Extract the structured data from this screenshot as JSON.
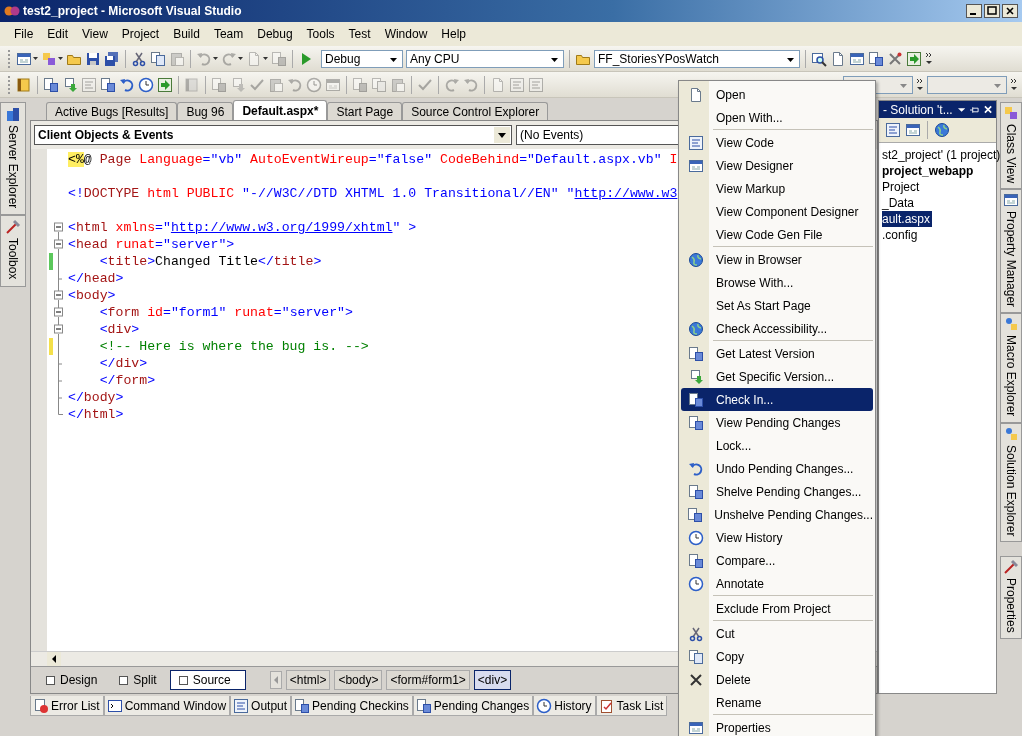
{
  "window": {
    "title": "test2_project - Microsoft Visual Studio"
  },
  "menu_bar": [
    "File",
    "Edit",
    "View",
    "Project",
    "Build",
    "Team",
    "Debug",
    "Tools",
    "Test",
    "Window",
    "Help"
  ],
  "toolbar": {
    "configuration": "Debug",
    "platform": "Any CPU",
    "startup_item": "FF_StoriesYPosWatch"
  },
  "side_tabs_left": [
    "Server Explorer",
    "Toolbox"
  ],
  "document_tabs": [
    {
      "label": "Active Bugs [Results]",
      "selected": false
    },
    {
      "label": "Bug 96",
      "selected": false
    },
    {
      "label": "Default.aspx*",
      "selected": true
    },
    {
      "label": "Start Page",
      "selected": false
    },
    {
      "label": "Source Control Explorer",
      "selected": false
    }
  ],
  "editor": {
    "object_list": "Client Objects & Events",
    "event_list": "(No Events)",
    "lines": [
      {
        "kind": "plain",
        "tokens": [
          {
            "kind": "hl",
            "text": "<%"
          },
          {
            "kind": "text",
            "text": "@"
          },
          {
            "kind": "tag",
            "text": " Page"
          },
          {
            "kind": "attr",
            "text": " Language"
          },
          {
            "kind": "delim",
            "text": "="
          },
          {
            "kind": "value",
            "text": "\"vb\""
          },
          {
            "kind": "attr",
            "text": " AutoEventWireup"
          },
          {
            "kind": "delim",
            "text": "="
          },
          {
            "kind": "value",
            "text": "\"false\""
          },
          {
            "kind": "attr",
            "text": " CodeBehind"
          },
          {
            "kind": "delim",
            "text": "="
          },
          {
            "kind": "value",
            "text": "\"Default.aspx.vb\""
          },
          {
            "kind": "attr",
            "text": " I"
          }
        ]
      },
      {
        "kind": "plain",
        "blank_before": true,
        "tokens": [
          {
            "kind": "delim",
            "text": "<!"
          },
          {
            "kind": "tag",
            "text": "DOCTYPE"
          },
          {
            "kind": "attr",
            "text": " html PUBLIC"
          },
          {
            "kind": "value",
            "text": " \"-//W3C//DTD XHTML 1.0 Transitional//EN\" \""
          },
          {
            "kind": "link",
            "text": "http://www.w3"
          }
        ]
      },
      {
        "kind": "fold-start",
        "blank_before": true,
        "tokens": [
          {
            "kind": "delim",
            "text": "<"
          },
          {
            "kind": "tag",
            "text": "html"
          },
          {
            "kind": "attr",
            "text": " xmlns"
          },
          {
            "kind": "delim",
            "text": "="
          },
          {
            "kind": "value",
            "text": "\""
          },
          {
            "kind": "link",
            "text": "http://www.w3.org/1999/xhtml"
          },
          {
            "kind": "value",
            "text": "\" >"
          }
        ]
      },
      {
        "kind": "fold-start",
        "tokens": [
          {
            "kind": "delim",
            "text": "<"
          },
          {
            "kind": "tag",
            "text": "head"
          },
          {
            "kind": "attr",
            "text": " runat"
          },
          {
            "kind": "delim",
            "text": "="
          },
          {
            "kind": "value",
            "text": "\"server\""
          },
          {
            "kind": "delim",
            "text": ">"
          }
        ]
      },
      {
        "kind": "fold-inner",
        "color": "#5cc85c",
        "tokens": [
          {
            "kind": "delim",
            "text": "    <"
          },
          {
            "kind": "tag",
            "text": "title"
          },
          {
            "kind": "delim",
            "text": ">"
          },
          {
            "kind": "text",
            "text": "Changed Title"
          },
          {
            "kind": "delim",
            "text": "</"
          },
          {
            "kind": "tag",
            "text": "title"
          },
          {
            "kind": "delim",
            "text": ">"
          }
        ]
      },
      {
        "kind": "fold-end",
        "tokens": [
          {
            "kind": "delim",
            "text": "</"
          },
          {
            "kind": "tag",
            "text": "head"
          },
          {
            "kind": "delim",
            "text": ">"
          }
        ]
      },
      {
        "kind": "fold-start",
        "tokens": [
          {
            "kind": "delim",
            "text": "<"
          },
          {
            "kind": "tag",
            "text": "body"
          },
          {
            "kind": "delim",
            "text": ">"
          }
        ]
      },
      {
        "kind": "fold-start",
        "tokens": [
          {
            "kind": "delim",
            "text": "    <"
          },
          {
            "kind": "tag",
            "text": "form"
          },
          {
            "kind": "attr",
            "text": " id"
          },
          {
            "kind": "delim",
            "text": "="
          },
          {
            "kind": "value",
            "text": "\"form1\""
          },
          {
            "kind": "attr",
            "text": " runat"
          },
          {
            "kind": "delim",
            "text": "="
          },
          {
            "kind": "value",
            "text": "\"server\""
          },
          {
            "kind": "delim",
            "text": ">"
          }
        ]
      },
      {
        "kind": "fold-start",
        "tokens": [
          {
            "kind": "delim",
            "text": "    <"
          },
          {
            "kind": "tag",
            "text": "div"
          },
          {
            "kind": "delim",
            "text": ">"
          }
        ]
      },
      {
        "kind": "fold-inner",
        "color": "#f4e04a",
        "tokens": [
          {
            "kind": "comment",
            "text": "    <!-- Here is where the bug is. -->"
          }
        ]
      },
      {
        "kind": "fold-end",
        "tokens": [
          {
            "kind": "delim",
            "text": "    </"
          },
          {
            "kind": "tag",
            "text": "div"
          },
          {
            "kind": "delim",
            "text": ">"
          }
        ]
      },
      {
        "kind": "fold-end",
        "tokens": [
          {
            "kind": "delim",
            "text": "    </"
          },
          {
            "kind": "tag",
            "text": "form"
          },
          {
            "kind": "delim",
            "text": ">"
          }
        ]
      },
      {
        "kind": "fold-end",
        "tokens": [
          {
            "kind": "delim",
            "text": "</"
          },
          {
            "kind": "tag",
            "text": "body"
          },
          {
            "kind": "delim",
            "text": ">"
          }
        ]
      },
      {
        "kind": "fold-last",
        "tokens": [
          {
            "kind": "delim",
            "text": "</"
          },
          {
            "kind": "tag",
            "text": "html"
          },
          {
            "kind": "delim",
            "text": ">"
          }
        ]
      }
    ]
  },
  "view_tabs": [
    {
      "label": "Design",
      "selected": false
    },
    {
      "label": "Split",
      "selected": false
    },
    {
      "label": "Source",
      "selected": true
    }
  ],
  "breadcrumbs": [
    {
      "label": "<html>",
      "selected": false
    },
    {
      "label": "<body>",
      "selected": false
    },
    {
      "label": "<form#form1>",
      "selected": false
    },
    {
      "label": "<div>",
      "selected": true
    }
  ],
  "solution_explorer": {
    "title": "- Solution 't...",
    "items": [
      {
        "label": "st2_project' (1 project)",
        "kind": "solution",
        "selected": false
      },
      {
        "label": "project_webapp",
        "kind": "project",
        "selected": false
      },
      {
        "label": "Project",
        "kind": "item",
        "selected": false
      },
      {
        "label": "_Data",
        "kind": "item",
        "selected": false
      },
      {
        "label": "ault.aspx",
        "kind": "item",
        "selected": true
      },
      {
        "label": ".config",
        "kind": "item",
        "selected": false
      }
    ]
  },
  "side_tabs_right": [
    "Class View",
    "Property Manager",
    "Macro Explorer",
    "Solution Explorer",
    "Properties"
  ],
  "tool_tabs": [
    "Error List",
    "Command Window",
    "Output",
    "Pending Checkins",
    "Pending Changes",
    "History",
    "Task List"
  ],
  "context_menu": {
    "groups": [
      [
        {
          "label": "Open",
          "selected": false
        },
        {
          "label": "Open With...",
          "selected": false
        }
      ],
      [
        {
          "label": "View Code",
          "selected": false
        },
        {
          "label": "View Designer",
          "selected": false
        },
        {
          "label": "View Markup",
          "selected": false
        },
        {
          "label": "View Component Designer",
          "selected": false
        },
        {
          "label": "View Code Gen File",
          "selected": false
        }
      ],
      [
        {
          "label": "View in Browser",
          "selected": false
        },
        {
          "label": "Browse With...",
          "selected": false
        },
        {
          "label": "Set As Start Page",
          "selected": false
        },
        {
          "label": "Check Accessibility...",
          "selected": false
        }
      ],
      [
        {
          "label": "Get Latest Version",
          "selected": false
        },
        {
          "label": "Get Specific Version...",
          "selected": false
        },
        {
          "label": "Check In...",
          "selected": true
        },
        {
          "label": "View Pending Changes",
          "selected": false
        },
        {
          "label": "Lock...",
          "selected": false
        },
        {
          "label": "Undo Pending Changes...",
          "selected": false
        },
        {
          "label": "Shelve Pending Changes...",
          "selected": false
        },
        {
          "label": "Unshelve Pending Changes...",
          "selected": false
        },
        {
          "label": "View History",
          "selected": false
        },
        {
          "label": "Compare...",
          "selected": false
        },
        {
          "label": "Annotate",
          "selected": false
        }
      ],
      [
        {
          "label": "Exclude From Project",
          "selected": false
        }
      ],
      [
        {
          "label": "Cut",
          "selected": false
        },
        {
          "label": "Copy",
          "selected": false
        },
        {
          "label": "Delete",
          "selected": false
        },
        {
          "label": "Rename",
          "selected": false
        }
      ],
      [
        {
          "label": "Properties",
          "selected": false
        }
      ]
    ]
  }
}
